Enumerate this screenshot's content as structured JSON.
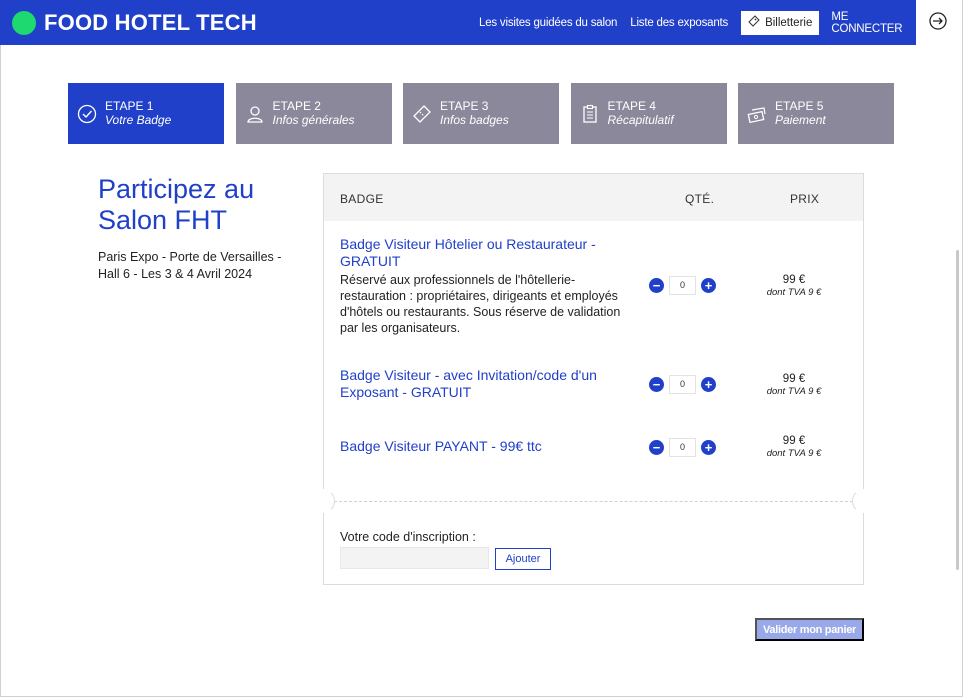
{
  "header": {
    "brand": "FOOD HOTEL TECH",
    "nav": [
      "Les visites guidées du salon",
      "Liste des exposants"
    ],
    "ticket_button": "Billetterie",
    "login": "ME CONNECTER",
    "logout_icon": "sign-out-icon"
  },
  "steps": [
    {
      "title": "ETAPE 1",
      "subtitle": "Votre Badge",
      "icon": "check-circle-icon",
      "active": true
    },
    {
      "title": "ETAPE 2",
      "subtitle": "Infos générales",
      "icon": "user-icon",
      "active": false
    },
    {
      "title": "ETAPE 3",
      "subtitle": "Infos badges",
      "icon": "ticket-icon",
      "active": false
    },
    {
      "title": "ETAPE 4",
      "subtitle": "Récapitulatif",
      "icon": "clipboard-icon",
      "active": false
    },
    {
      "title": "ETAPE 5",
      "subtitle": "Paiement",
      "icon": "money-icon",
      "active": false
    }
  ],
  "event": {
    "title": "Participez au Salon FHT",
    "info": "Paris Expo - Porte de Versailles - Hall 6 - Les 3 & 4 Avril 2024"
  },
  "table": {
    "col_badge": "BADGE",
    "col_qty": "QTÉ.",
    "col_price": "PRIX"
  },
  "badges": [
    {
      "title": "Badge Visiteur Hôtelier ou Restaurateur - GRATUIT",
      "description": "Réservé aux professionnels de l'hôtellerie-restauration : propriétaires, dirigeants et employés d'hôtels ou restaurants. Sous réserve de validation par les organisateurs.",
      "qty": "0",
      "price": "99 €",
      "tva": "dont TVA 9 €"
    },
    {
      "title": "Badge Visiteur - avec Invitation/code d'un Exposant - GRATUIT",
      "description": "",
      "qty": "0",
      "price": "99 €",
      "tva": "dont TVA 9 €"
    },
    {
      "title": "Badge Visiteur PAYANT - 99€ ttc",
      "description": "",
      "qty": "0",
      "price": "99 €",
      "tva": "dont TVA 9 €"
    }
  ],
  "code": {
    "label": "Votre code d'inscription :",
    "placeholder": "",
    "add_button": "Ajouter"
  },
  "validate_button": "Valider mon panier",
  "colors": {
    "primary": "#2140c9",
    "step_inactive": "#8c889c",
    "brand_dot": "#1ed870",
    "validate_disabled": "#99a8e8"
  }
}
